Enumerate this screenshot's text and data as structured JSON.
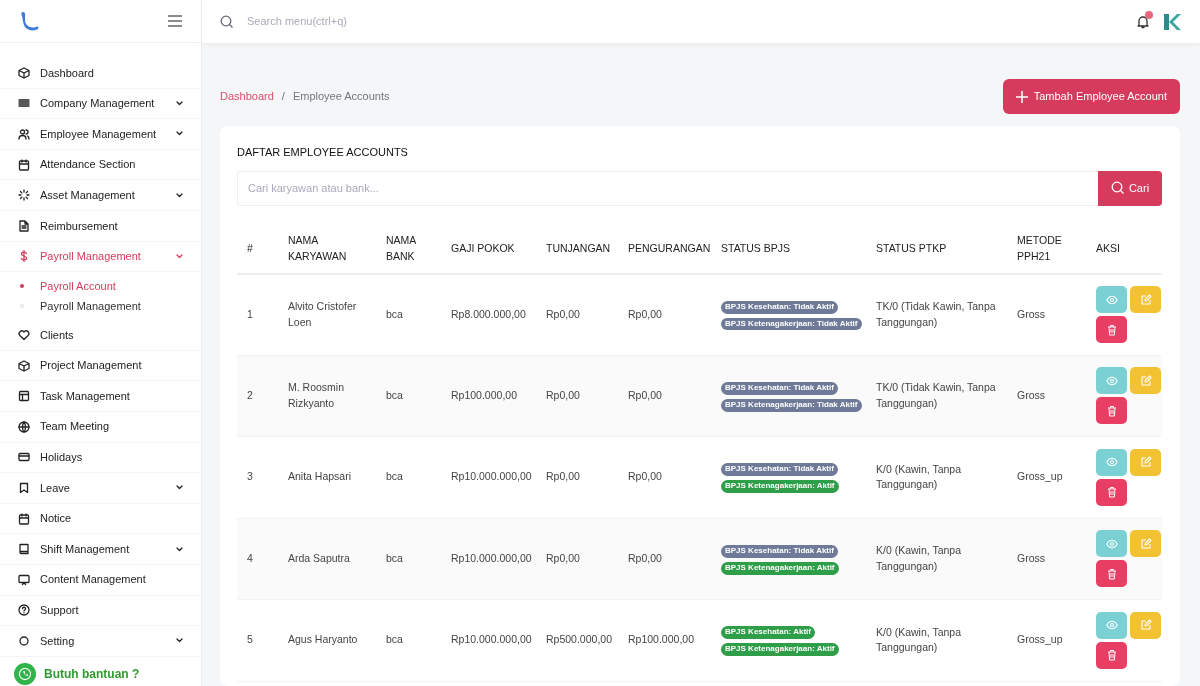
{
  "sidebar": {
    "items": [
      {
        "label": "Dashboard",
        "expandable": false,
        "selected": false
      },
      {
        "label": "Company Management",
        "expandable": true,
        "selected": false
      },
      {
        "label": "Employee Management",
        "expandable": true,
        "selected": false
      },
      {
        "label": "Attendance Section",
        "expandable": false,
        "selected": false
      },
      {
        "label": "Asset Management",
        "expandable": true,
        "selected": false
      },
      {
        "label": "Reimbursement",
        "expandable": false,
        "selected": false
      },
      {
        "label": "Payroll Management",
        "expandable": true,
        "selected": true,
        "children": [
          {
            "label": "Payroll Account",
            "selected": true
          },
          {
            "label": "Payroll Management",
            "selected": false
          }
        ]
      },
      {
        "label": "Clients",
        "expandable": false,
        "selected": false
      },
      {
        "label": "Project Management",
        "expandable": false,
        "selected": false
      },
      {
        "label": "Task Management",
        "expandable": false,
        "selected": false
      },
      {
        "label": "Team Meeting",
        "expandable": false,
        "selected": false
      },
      {
        "label": "Holidays",
        "expandable": false,
        "selected": false
      },
      {
        "label": "Leave",
        "expandable": true,
        "selected": false
      },
      {
        "label": "Notice",
        "expandable": false,
        "selected": false
      },
      {
        "label": "Shift Management",
        "expandable": true,
        "selected": false
      },
      {
        "label": "Content Management",
        "expandable": false,
        "selected": false
      },
      {
        "label": "Support",
        "expandable": false,
        "selected": false
      },
      {
        "label": "Setting",
        "expandable": true,
        "selected": false
      }
    ]
  },
  "topbar": {
    "search": {
      "placeholder": "Search menu(ctrl+q)"
    },
    "notification": true
  },
  "breadcrumb": [
    {
      "label": "Dashboard",
      "link": true
    },
    {
      "label": "Employee Accounts",
      "link": false
    }
  ],
  "breadcrumb_separator": "/",
  "add_button": "Tambah Employee Account",
  "card": {
    "title": "DAFTAR EMPLOYEE ACCOUNTS",
    "search": {
      "placeholder": "Cari karyawan atau bank...",
      "button": "Cari"
    },
    "table": {
      "columns": [
        "#",
        "NAMA KARYAWAN",
        "NAMA BANK",
        "GAJI POKOK",
        "TUNJANGAN",
        "PENGURANGAN",
        "STATUS BPJS",
        "STATUS PTKP",
        "METODE PPH21",
        "AKSI"
      ],
      "rows": [
        {
          "no": "1",
          "name": "Alvito Cristofer Loen",
          "bank": "bca",
          "salary": "Rp8.000.000,00",
          "allowance": "Rp0,00",
          "deduction": "Rp0,00",
          "bpjs": [
            {
              "label": "BPJS Kesehatan: Tidak Aktif",
              "active": false
            },
            {
              "label": "BPJS Ketenagakerjaan: Tidak Aktif",
              "active": false
            }
          ],
          "ptkp": "TK/0 (Tidak Kawin, Tanpa Tanggungan)",
          "method": "Gross"
        },
        {
          "no": "2",
          "name": "M. Roosmin Rizkyanto",
          "bank": "bca",
          "salary": "Rp100.000,00",
          "allowance": "Rp0,00",
          "deduction": "Rp0,00",
          "bpjs": [
            {
              "label": "BPJS Kesehatan: Tidak Aktif",
              "active": false
            },
            {
              "label": "BPJS Ketenagakerjaan: Tidak Aktif",
              "active": false
            }
          ],
          "ptkp": "TK/0 (Tidak Kawin, Tanpa Tanggungan)",
          "method": "Gross"
        },
        {
          "no": "3",
          "name": "Anita Hapsari",
          "bank": "bca",
          "salary": "Rp10.000.000,00",
          "allowance": "Rp0,00",
          "deduction": "Rp0,00",
          "bpjs": [
            {
              "label": "BPJS Kesehatan: Tidak Aktif",
              "active": false
            },
            {
              "label": "BPJS Ketenagakerjaan: Aktif",
              "active": true
            }
          ],
          "ptkp": "K/0 (Kawin, Tanpa Tanggungan)",
          "method": "Gross_up"
        },
        {
          "no": "4",
          "name": "Arda Saputra",
          "bank": "bca",
          "salary": "Rp10.000.000,00",
          "allowance": "Rp0,00",
          "deduction": "Rp0,00",
          "bpjs": [
            {
              "label": "BPJS Kesehatan: Tidak Aktif",
              "active": false
            },
            {
              "label": "BPJS Ketenagakerjaan: Aktif",
              "active": true
            }
          ],
          "ptkp": "K/0 (Kawin, Tanpa Tanggungan)",
          "method": "Gross"
        },
        {
          "no": "5",
          "name": "Agus Haryanto",
          "bank": "bca",
          "salary": "Rp10.000.000,00",
          "allowance": "Rp500.000,00",
          "deduction": "Rp100.000,00",
          "bpjs": [
            {
              "label": "BPJS Kesehatan: Aktif",
              "active": true
            },
            {
              "label": "BPJS Ketenagakerjaan: Aktif",
              "active": true
            }
          ],
          "ptkp": "K/0 (Kawin, Tanpa Tanggungan)",
          "method": "Gross_up"
        }
      ]
    }
  },
  "help_widget": "Butuh bantuan ?"
}
